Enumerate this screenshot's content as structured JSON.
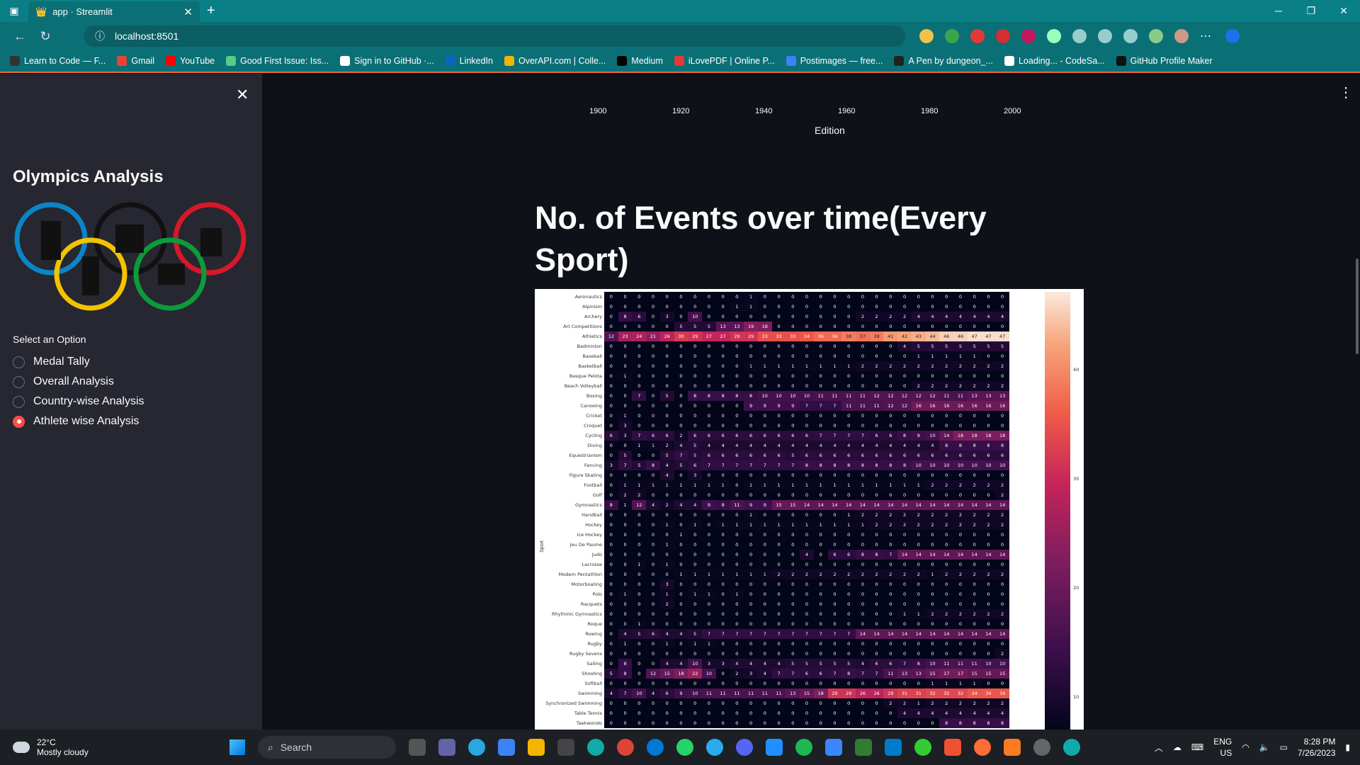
{
  "browser": {
    "tab_title": "app · Streamlit",
    "url": "localhost:8501",
    "bookmarks": [
      "Learn to Code — F...",
      "Gmail",
      "YouTube",
      "Good First Issue: Iss...",
      "Sign in to GitHub ·...",
      "LinkedIn",
      "OverAPI.com | Colle...",
      "Medium",
      "iLovePDF | Online P...",
      "Postimages — free...",
      "A Pen by dungeon_...",
      "Loading... - CodeSa...",
      "GitHub Profile Maker"
    ]
  },
  "sidebar": {
    "title": "Olympics Analysis",
    "select_label": "Select an Option",
    "options": [
      "Medal Tally",
      "Overall Analysis",
      "Country-wise Analysis",
      "Athlete wise Analysis"
    ],
    "selected_index": 3
  },
  "main": {
    "prev_chart_xticks": [
      "1900",
      "1920",
      "1940",
      "1960",
      "1980",
      "2000"
    ],
    "prev_chart_xlabel": "Edition",
    "heading": "No. of Events over time(Every Sport)"
  },
  "chart_data": {
    "type": "heatmap",
    "ylabel": "Sport",
    "colorbar_ticks": [
      "40",
      "30",
      "20",
      "10"
    ],
    "sports": [
      "Aeronautics",
      "Alpinism",
      "Archery",
      "Art Competitions",
      "Athletics",
      "Badminton",
      "Baseball",
      "Basketball",
      "Basque Pelota",
      "Beach Volleyball",
      "Boxing",
      "Canoeing",
      "Cricket",
      "Croquet",
      "Cycling",
      "Diving",
      "Equestrianism",
      "Fencing",
      "Figure Skating",
      "Football",
      "Golf",
      "Gymnastics",
      "Handball",
      "Hockey",
      "Ice Hockey",
      "Jeu De Paume",
      "Judo",
      "Lacrosse",
      "Modern Pentathlon",
      "Motorboating",
      "Polo",
      "Racquets",
      "Rhythmic Gymnastics",
      "Roque",
      "Rowing",
      "Rugby",
      "Rugby Sevens",
      "Sailing",
      "Shooting",
      "Softball",
      "Swimming",
      "Synchronized Swimming",
      "Table Tennis",
      "Taekwondo"
    ],
    "values": [
      [
        0,
        0,
        0,
        0,
        0,
        0,
        0,
        0,
        0,
        0,
        1,
        0,
        0,
        0,
        0,
        0,
        0,
        0,
        0,
        0,
        0,
        0,
        0,
        0,
        0,
        0,
        0,
        0,
        0
      ],
      [
        0,
        0,
        0,
        0,
        0,
        0,
        0,
        0,
        0,
        1,
        1,
        0,
        0,
        0,
        0,
        0,
        0,
        0,
        0,
        0,
        0,
        0,
        0,
        0,
        0,
        0,
        0,
        0,
        0
      ],
      [
        0,
        8,
        6,
        0,
        3,
        0,
        10,
        0,
        0,
        0,
        0,
        0,
        0,
        0,
        0,
        0,
        0,
        0,
        2,
        2,
        2,
        2,
        4,
        4,
        4,
        4,
        4,
        4,
        4
      ],
      [
        0,
        0,
        0,
        0,
        0,
        5,
        5,
        5,
        13,
        13,
        19,
        18,
        0,
        0,
        0,
        0,
        0,
        0,
        0,
        0,
        0,
        0,
        0,
        0,
        0,
        0,
        0,
        0,
        0
      ],
      [
        12,
        23,
        24,
        21,
        26,
        30,
        29,
        27,
        27,
        29,
        29,
        33,
        33,
        33,
        34,
        36,
        36,
        38,
        37,
        38,
        41,
        42,
        43,
        44,
        46,
        46,
        47,
        47,
        47
      ],
      [
        0,
        0,
        0,
        0,
        0,
        0,
        0,
        0,
        0,
        0,
        0,
        0,
        0,
        0,
        0,
        0,
        0,
        0,
        0,
        0,
        0,
        4,
        5,
        5,
        5,
        5,
        5,
        5,
        5
      ],
      [
        0,
        0,
        0,
        0,
        0,
        0,
        0,
        0,
        0,
        0,
        0,
        0,
        0,
        0,
        0,
        0,
        0,
        0,
        0,
        0,
        0,
        0,
        1,
        1,
        1,
        1,
        1,
        0,
        0
      ],
      [
        0,
        0,
        0,
        0,
        0,
        0,
        0,
        0,
        0,
        0,
        1,
        1,
        1,
        1,
        1,
        1,
        1,
        1,
        2,
        2,
        2,
        2,
        2,
        2,
        2,
        2,
        2,
        2,
        2
      ],
      [
        0,
        1,
        0,
        0,
        0,
        0,
        0,
        0,
        0,
        0,
        0,
        0,
        0,
        0,
        0,
        0,
        0,
        0,
        0,
        0,
        0,
        0,
        0,
        0,
        0,
        0,
        0,
        0,
        0
      ],
      [
        0,
        0,
        0,
        0,
        0,
        0,
        0,
        0,
        0,
        0,
        0,
        0,
        0,
        0,
        0,
        0,
        0,
        0,
        0,
        0,
        0,
        0,
        2,
        2,
        2,
        2,
        2,
        2,
        2
      ],
      [
        0,
        0,
        7,
        0,
        5,
        0,
        8,
        8,
        8,
        8,
        8,
        10,
        10,
        10,
        10,
        11,
        11,
        11,
        11,
        12,
        12,
        12,
        12,
        12,
        11,
        11,
        13,
        13,
        13
      ],
      [
        0,
        0,
        0,
        0,
        0,
        0,
        0,
        0,
        0,
        0,
        9,
        9,
        9,
        9,
        7,
        7,
        7,
        11,
        11,
        11,
        12,
        12,
        16,
        16,
        16,
        16,
        16,
        16,
        16
      ],
      [
        0,
        1,
        0,
        0,
        0,
        0,
        0,
        0,
        0,
        0,
        0,
        0,
        0,
        0,
        0,
        0,
        0,
        0,
        0,
        0,
        0,
        0,
        0,
        0,
        0,
        0,
        0,
        0,
        0
      ],
      [
        0,
        3,
        0,
        0,
        0,
        0,
        0,
        0,
        0,
        0,
        0,
        0,
        0,
        0,
        0,
        0,
        0,
        0,
        0,
        0,
        0,
        0,
        0,
        0,
        0,
        0,
        0,
        0,
        0
      ],
      [
        6,
        3,
        7,
        6,
        6,
        2,
        6,
        6,
        6,
        6,
        6,
        6,
        6,
        6,
        6,
        7,
        7,
        7,
        7,
        6,
        6,
        8,
        9,
        10,
        14,
        18,
        18,
        18,
        18
      ],
      [
        0,
        0,
        1,
        1,
        2,
        4,
        5,
        4,
        4,
        4,
        4,
        4,
        4,
        4,
        4,
        4,
        4,
        4,
        4,
        4,
        4,
        4,
        4,
        4,
        8,
        8,
        8,
        8,
        8
      ],
      [
        0,
        5,
        0,
        0,
        5,
        7,
        5,
        6,
        6,
        6,
        6,
        6,
        6,
        5,
        6,
        6,
        6,
        6,
        6,
        6,
        6,
        6,
        6,
        6,
        6,
        6,
        6,
        6,
        6
      ],
      [
        3,
        7,
        5,
        8,
        4,
        5,
        6,
        7,
        7,
        7,
        7,
        7,
        7,
        7,
        8,
        8,
        8,
        8,
        8,
        8,
        8,
        8,
        10,
        10,
        10,
        10,
        10,
        10,
        10
      ],
      [
        0,
        0,
        0,
        0,
        4,
        0,
        3,
        0,
        0,
        0,
        0,
        0,
        0,
        0,
        0,
        0,
        0,
        0,
        0,
        0,
        0,
        0,
        0,
        0,
        0,
        0,
        0,
        0,
        0
      ],
      [
        0,
        1,
        1,
        1,
        1,
        1,
        1,
        1,
        1,
        0,
        1,
        1,
        1,
        1,
        1,
        1,
        1,
        1,
        1,
        1,
        1,
        1,
        1,
        2,
        2,
        2,
        2,
        2,
        2
      ],
      [
        0,
        2,
        2,
        0,
        0,
        0,
        0,
        0,
        0,
        0,
        0,
        0,
        0,
        0,
        0,
        0,
        0,
        0,
        0,
        0,
        0,
        0,
        0,
        0,
        0,
        0,
        0,
        0,
        2
      ],
      [
        8,
        1,
        12,
        4,
        2,
        4,
        4,
        9,
        8,
        11,
        9,
        9,
        15,
        15,
        14,
        14,
        14,
        14,
        14,
        14,
        14,
        14,
        14,
        14,
        14,
        14,
        14,
        14,
        14
      ],
      [
        0,
        0,
        0,
        0,
        0,
        0,
        0,
        0,
        0,
        0,
        1,
        0,
        0,
        0,
        0,
        0,
        0,
        1,
        2,
        2,
        2,
        2,
        2,
        2,
        2,
        2,
        2,
        2,
        2
      ],
      [
        0,
        0,
        0,
        0,
        1,
        0,
        1,
        0,
        1,
        1,
        1,
        1,
        1,
        1,
        1,
        1,
        1,
        1,
        1,
        2,
        2,
        2,
        2,
        2,
        2,
        2,
        2,
        2,
        2
      ],
      [
        0,
        0,
        0,
        0,
        0,
        1,
        0,
        0,
        0,
        0,
        0,
        0,
        0,
        0,
        0,
        0,
        0,
        0,
        0,
        0,
        0,
        0,
        0,
        0,
        0,
        0,
        0,
        0,
        0
      ],
      [
        0,
        0,
        0,
        0,
        1,
        0,
        0,
        0,
        0,
        0,
        0,
        0,
        0,
        0,
        0,
        0,
        0,
        0,
        0,
        0,
        0,
        0,
        0,
        0,
        0,
        0,
        0,
        0,
        0
      ],
      [
        0,
        0,
        0,
        0,
        0,
        0,
        0,
        0,
        0,
        0,
        0,
        0,
        0,
        0,
        4,
        0,
        6,
        6,
        8,
        8,
        7,
        14,
        14,
        14,
        14,
        14,
        14,
        14,
        14
      ],
      [
        0,
        0,
        1,
        0,
        1,
        0,
        0,
        0,
        0,
        0,
        0,
        0,
        0,
        0,
        0,
        0,
        0,
        0,
        0,
        0,
        0,
        0,
        0,
        0,
        0,
        0,
        0,
        0,
        0
      ],
      [
        0,
        0,
        0,
        0,
        0,
        1,
        1,
        1,
        1,
        1,
        1,
        1,
        2,
        2,
        2,
        2,
        2,
        2,
        2,
        2,
        2,
        2,
        2,
        1,
        2,
        2,
        2,
        2,
        2
      ],
      [
        0,
        0,
        0,
        0,
        3,
        0,
        0,
        0,
        0,
        0,
        0,
        0,
        0,
        0,
        0,
        0,
        0,
        0,
        0,
        0,
        0,
        0,
        0,
        0,
        0,
        0,
        0,
        0,
        0
      ],
      [
        0,
        1,
        0,
        0,
        1,
        0,
        1,
        1,
        0,
        1,
        0,
        0,
        0,
        0,
        0,
        0,
        0,
        0,
        0,
        0,
        0,
        0,
        0,
        0,
        0,
        0,
        0,
        0,
        0
      ],
      [
        0,
        0,
        0,
        0,
        2,
        0,
        0,
        0,
        0,
        0,
        0,
        0,
        0,
        0,
        0,
        0,
        0,
        0,
        0,
        0,
        0,
        0,
        0,
        0,
        0,
        0,
        0,
        0,
        0
      ],
      [
        0,
        0,
        0,
        0,
        0,
        0,
        0,
        0,
        0,
        0,
        0,
        0,
        0,
        0,
        0,
        0,
        0,
        0,
        0,
        0,
        0,
        1,
        1,
        2,
        2,
        2,
        2,
        2,
        2
      ],
      [
        0,
        0,
        1,
        0,
        0,
        0,
        0,
        0,
        0,
        0,
        0,
        0,
        0,
        0,
        0,
        0,
        0,
        0,
        0,
        0,
        0,
        0,
        0,
        0,
        0,
        0,
        0,
        0,
        0
      ],
      [
        0,
        4,
        5,
        6,
        4,
        4,
        5,
        7,
        7,
        7,
        7,
        7,
        7,
        7,
        7,
        7,
        7,
        7,
        14,
        14,
        14,
        14,
        14,
        14,
        14,
        14,
        14,
        14,
        14
      ],
      [
        0,
        1,
        0,
        0,
        1,
        0,
        1,
        1,
        0,
        0,
        0,
        0,
        0,
        0,
        0,
        0,
        0,
        0,
        0,
        0,
        0,
        0,
        0,
        0,
        0,
        0,
        0,
        0,
        0
      ],
      [
        0,
        0,
        0,
        0,
        0,
        0,
        0,
        0,
        0,
        0,
        0,
        0,
        0,
        0,
        0,
        0,
        0,
        0,
        0,
        0,
        0,
        0,
        0,
        0,
        0,
        0,
        0,
        0,
        2
      ],
      [
        0,
        8,
        0,
        0,
        4,
        4,
        10,
        3,
        3,
        4,
        4,
        4,
        4,
        5,
        5,
        5,
        5,
        5,
        4,
        6,
        6,
        7,
        8,
        10,
        11,
        11,
        11,
        10,
        10
      ],
      [
        5,
        8,
        0,
        12,
        15,
        18,
        22,
        10,
        0,
        2,
        3,
        4,
        7,
        7,
        6,
        6,
        7,
        8,
        7,
        7,
        11,
        13,
        13,
        15,
        17,
        17,
        15,
        15,
        15
      ],
      [
        0,
        0,
        0,
        0,
        0,
        0,
        0,
        0,
        0,
        0,
        0,
        0,
        0,
        0,
        0,
        0,
        0,
        0,
        0,
        0,
        0,
        0,
        0,
        1,
        1,
        1,
        1,
        0,
        0
      ],
      [
        4,
        7,
        10,
        4,
        6,
        9,
        10,
        11,
        11,
        11,
        11,
        11,
        11,
        13,
        15,
        18,
        29,
        29,
        26,
        26,
        29,
        31,
        31,
        32,
        32,
        32,
        34,
        34,
        34
      ],
      [
        0,
        0,
        0,
        0,
        0,
        0,
        0,
        0,
        0,
        0,
        0,
        0,
        0,
        0,
        0,
        0,
        0,
        0,
        0,
        0,
        2,
        2,
        1,
        2,
        2,
        2,
        2,
        2,
        2
      ],
      [
        0,
        0,
        0,
        0,
        0,
        0,
        0,
        0,
        0,
        0,
        0,
        0,
        0,
        0,
        0,
        0,
        0,
        0,
        0,
        0,
        0,
        4,
        4,
        4,
        4,
        4,
        4,
        4,
        4
      ],
      [
        0,
        0,
        0,
        0,
        0,
        0,
        0,
        0,
        0,
        0,
        0,
        0,
        0,
        0,
        0,
        0,
        0,
        0,
        0,
        0,
        0,
        0,
        0,
        0,
        8,
        8,
        8,
        8,
        8
      ]
    ]
  },
  "taskbar": {
    "temperature": "22°C",
    "weather": "Mostly cloudy",
    "search": "Search",
    "lang1": "ENG",
    "lang2": "US",
    "time": "8:28 PM",
    "date": "7/26/2023"
  }
}
